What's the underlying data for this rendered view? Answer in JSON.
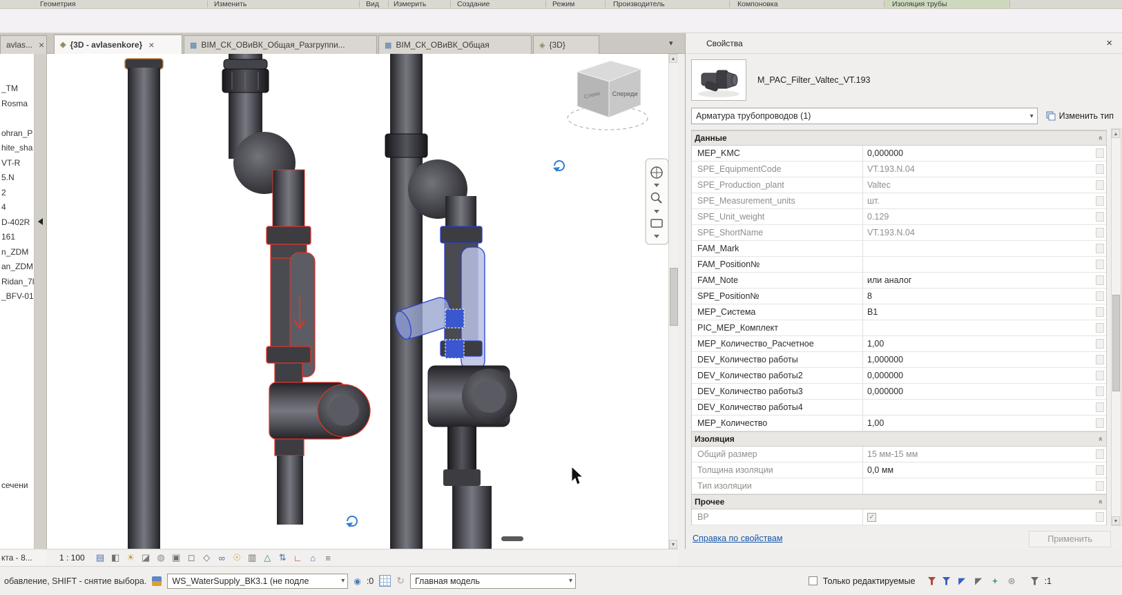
{
  "ribbon": {
    "panel_labels": [
      "Геометрия",
      "Изменить",
      "Вид",
      "Измерить",
      "Создание",
      "Режим",
      "Производитель",
      "Компоновка",
      "Изоляция трубы"
    ]
  },
  "view_tabs": [
    {
      "label": "avlas...",
      "icon": "",
      "active": false,
      "closable": true,
      "partial": true
    },
    {
      "label": "{3D - avlasenkore}",
      "icon": "3d-view-icon",
      "active": true,
      "closable": true,
      "partial": false
    },
    {
      "label": "BIM_СК_ОВиВК_Общая_Разгруппи...",
      "icon": "schedule-icon",
      "active": false,
      "closable": false,
      "partial": false
    },
    {
      "label": "BIM_СК_ОВиВК_Общая",
      "icon": "schedule-icon",
      "active": false,
      "closable": false,
      "partial": false
    },
    {
      "label": "{3D}",
      "icon": "3d-view-icon",
      "active": false,
      "closable": false,
      "partial": false
    }
  ],
  "project_browser": {
    "items": [
      "_TM",
      "Rosma",
      "",
      "ohran_P",
      "hite_sha",
      "VT-R",
      "5.N",
      "2",
      "4",
      "D-402R",
      "161",
      "n_ZDM",
      "an_ZDM",
      "Ridan_7l",
      "_BFV-01"
    ],
    "lower_item": "сечени",
    "bottom_item": "кта - 8..."
  },
  "viewport": {
    "viewcube_front": "Спереди",
    "viewcube_left": "Слева",
    "scale": "1 : 100"
  },
  "view_control_icons": [
    "detail-level-icon",
    "visual-style-icon",
    "sun-path-icon",
    "shadows-icon",
    "rendering-icon",
    "crop-view-icon",
    "show-crop-icon",
    "lock-view-icon",
    "temporary-hide-icon",
    "reveal-hidden-icon",
    "temporary-view-properties-icon",
    "analytical-model-icon",
    "displacement-icon",
    "constraints-icon",
    "worksharing-icon",
    "view-properties-icon"
  ],
  "properties": {
    "title": "Свойства",
    "type_name": "M_PAC_Filter_Valtec_VT.193",
    "category_selector": "Арматура трубопроводов (1)",
    "edit_type_label": "Изменить тип",
    "sections": [
      {
        "title": "Данные",
        "rows": [
          {
            "label": "MEP_KMC",
            "value": "0,000000",
            "lgray": false,
            "vgray": false
          },
          {
            "label": "SPE_EquipmentCode",
            "value": "VT.193.N.04",
            "lgray": true,
            "vgray": true
          },
          {
            "label": "SPE_Production_plant",
            "value": "Valtec",
            "lgray": true,
            "vgray": true
          },
          {
            "label": "SPE_Measurement_units",
            "value": "шт.",
            "lgray": true,
            "vgray": true
          },
          {
            "label": "SPE_Unit_weight",
            "value": "0.129",
            "lgray": true,
            "vgray": true
          },
          {
            "label": "SPE_ShortName",
            "value": "VT.193.N.04",
            "lgray": true,
            "vgray": true
          },
          {
            "label": "FAM_Mark",
            "value": "",
            "lgray": false,
            "vgray": false
          },
          {
            "label": "FAM_Position№",
            "value": "",
            "lgray": false,
            "vgray": false
          },
          {
            "label": "FAM_Note",
            "value": "или аналог",
            "lgray": false,
            "vgray": false
          },
          {
            "label": "SPE_Position№",
            "value": "8",
            "lgray": false,
            "vgray": false
          },
          {
            "label": "MEP_Система",
            "value": "В1",
            "lgray": false,
            "vgray": false
          },
          {
            "label": "PIC_MEP_Комплект",
            "value": "",
            "lgray": false,
            "vgray": false
          },
          {
            "label": "MEP_Количество_Расчетное",
            "value": "1,00",
            "lgray": false,
            "vgray": false
          },
          {
            "label": "DEV_Количество работы",
            "value": "1,000000",
            "lgray": false,
            "vgray": false
          },
          {
            "label": "DEV_Количество работы2",
            "value": "0,000000",
            "lgray": false,
            "vgray": false
          },
          {
            "label": "DEV_Количество работы3",
            "value": "0,000000",
            "lgray": false,
            "vgray": false
          },
          {
            "label": "DEV_Количество работы4",
            "value": "",
            "lgray": false,
            "vgray": false
          },
          {
            "label": "MEP_Количество",
            "value": "1,00",
            "lgray": false,
            "vgray": false
          }
        ]
      },
      {
        "title": "Изоляция",
        "rows": [
          {
            "label": "Общий размер",
            "value": "15 мм-15 мм",
            "lgray": true,
            "vgray": true
          },
          {
            "label": "Толщина изоляции",
            "value": "0,0 мм",
            "lgray": true,
            "vgray": false
          },
          {
            "label": "Тип изоляции",
            "value": "",
            "lgray": true,
            "vgray": true
          }
        ]
      },
      {
        "title": "Прочее",
        "rows": [
          {
            "label": "ВР",
            "value": "",
            "checkbox": true,
            "checked": true,
            "lgray": true,
            "vgray": true
          }
        ]
      }
    ],
    "help_link": "Справка по свойствам",
    "apply_label": "Применить"
  },
  "status_bar": {
    "hint": "обавление, SHIFT - снятие выбора.",
    "workset_selector": "WS_WaterSupply_ВК3.1 (не подле",
    "requests_count": ":0",
    "design_option_selector": "Главная модель",
    "editable_only_label": "Только редактируемые",
    "right_icons": [
      "filter-edit-icon",
      "filter-clear-icon",
      "select-link-icon",
      "select-pin-icon",
      "drag-select-icon",
      "background-process-icon"
    ],
    "selection_count": ":1"
  }
}
